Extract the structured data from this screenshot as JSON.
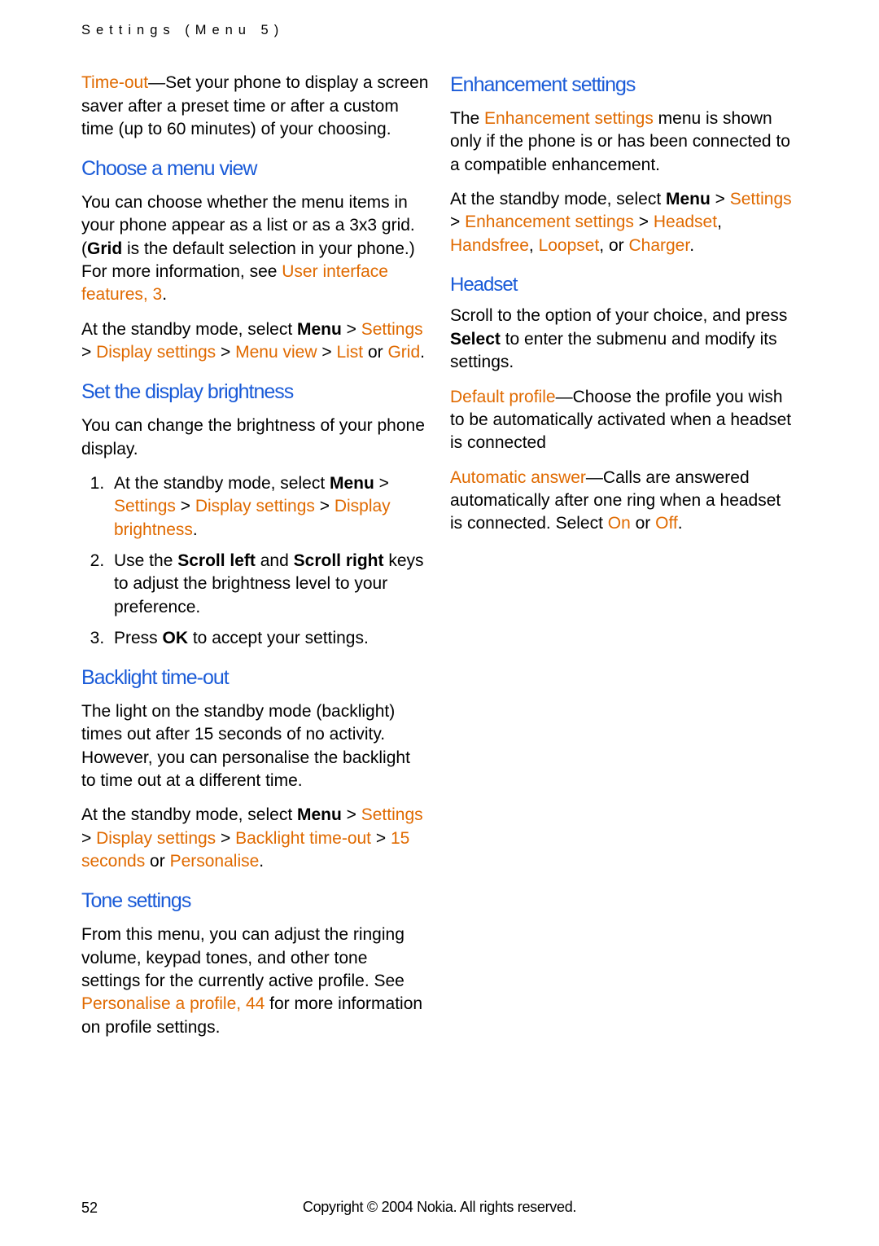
{
  "header": "Settings (Menu 5)",
  "page_number": "52",
  "copyright": "Copyright © 2004 Nokia. All rights reserved.",
  "col1": {
    "timeout_label": "Time-out",
    "timeout_body": "—Set your phone to display a screen saver after a preset time or after a custom time (up to 60 minutes) of your choosing.",
    "choose_h": "Choose a menu view",
    "choose_p1a": "You can choose whether the menu items in your phone appear as a list or as a 3x3 grid. (",
    "choose_grid": "Grid",
    "choose_p1b": " is the default selection in your phone.) For more information, see ",
    "choose_link1": "User interface features, 3",
    "choose_p1c": ".",
    "choose_p2a": "At the standby mode, select ",
    "choose_menu": "Menu",
    "choose_gt1": " > ",
    "choose_settings": "Settings",
    "choose_gt2": " > ",
    "choose_display": "Display settings",
    "choose_gt3": " > ",
    "choose_menuview": "Menu view",
    "choose_gt4": " > ",
    "choose_list": "List",
    "choose_or": " or ",
    "choose_grid2": "Grid",
    "choose_dot": ".",
    "bright_h": "Set the display brightness",
    "bright_intro": "You can change the brightness of your phone display.",
    "bright_li1a": "At the standby mode, select ",
    "bright_li1_m": "Menu",
    "bright_li1_gt1": " > ",
    "bright_li1_s": "Settings",
    "bright_li1_gt2": " > ",
    "bright_li1_ds": "Display settings",
    "bright_li1_gt3": " > ",
    "bright_li1_db": "Display brightness",
    "bright_li1_dot": ".",
    "bright_li2a": "Use the ",
    "bright_li2_sl": "Scroll left",
    "bright_li2_and": " and ",
    "bright_li2_sr": "Scroll right",
    "bright_li2b": " keys to adjust the brightness level to your preference.",
    "bright_li3a": "Press ",
    "bright_li3_ok": "OK",
    "bright_li3b": " to accept your settings.",
    "backlight_h": "Backlight time-out",
    "backlight_p1": "The light on the standby mode (backlight) times out after 15 seconds of no activity. However, you can personalise the backlight to time out at a different time.",
    "backlight_p2a": "At the standby mode, select ",
    "backlight_menu": "Menu",
    "backlight_gt1": " > ",
    "backlight_settings": "Settings",
    "backlight_gt2": " > ",
    "backlight_ds": "Display settings",
    "backlight_gt3": " > "
  },
  "col2": {
    "backlight_bt": "Backlight time-out",
    "backlight_gt4": " > ",
    "backlight_15": "15 seconds",
    "backlight_or": " or ",
    "backlight_pers": "Personalise",
    "backlight_dot": ".",
    "tone_h": "Tone settings",
    "tone_p1a": "From this menu, you can adjust the ringing volume, keypad tones, and other tone settings for the currently active profile. See ",
    "tone_link": "Personalise a profile, 44",
    "tone_p1b": " for more information on profile settings.",
    "enh_h": "Enhancement settings",
    "enh_p1a": "The ",
    "enh_menu_label": "Enhancement settings",
    "enh_p1b": " menu is shown only if the phone is or has been connected to a compatible enhancement.",
    "enh_p2a": "At the standby mode, select ",
    "enh_menu": "Menu",
    "enh_gt1": " > ",
    "enh_settings": "Settings",
    "enh_gt2": " > ",
    "enh_es": "Enhancement settings",
    "enh_gt3": " > ",
    "enh_headset": "Headset",
    "enh_c1": ", ",
    "enh_hands": "Handsfree",
    "enh_c2": ", ",
    "enh_loop": "Loopset",
    "enh_c3": ", or ",
    "enh_charger": "Charger",
    "enh_dot": ".",
    "headset_h": "Headset",
    "headset_p1a": "Scroll to the option of your choice, and press ",
    "headset_select": "Select",
    "headset_p1b": " to enter the submenu and modify its settings.",
    "headset_dp": "Default profile",
    "headset_dp_body": "—Choose the profile you wish to be automatically activated when a headset is connected",
    "headset_aa": "Automatic answer",
    "headset_aa_body1": "—Calls are answered automatically after one ring when a headset is connected. Select ",
    "headset_on": "On",
    "headset_or": " or ",
    "headset_off": "Off",
    "headset_aa_dot": "."
  }
}
